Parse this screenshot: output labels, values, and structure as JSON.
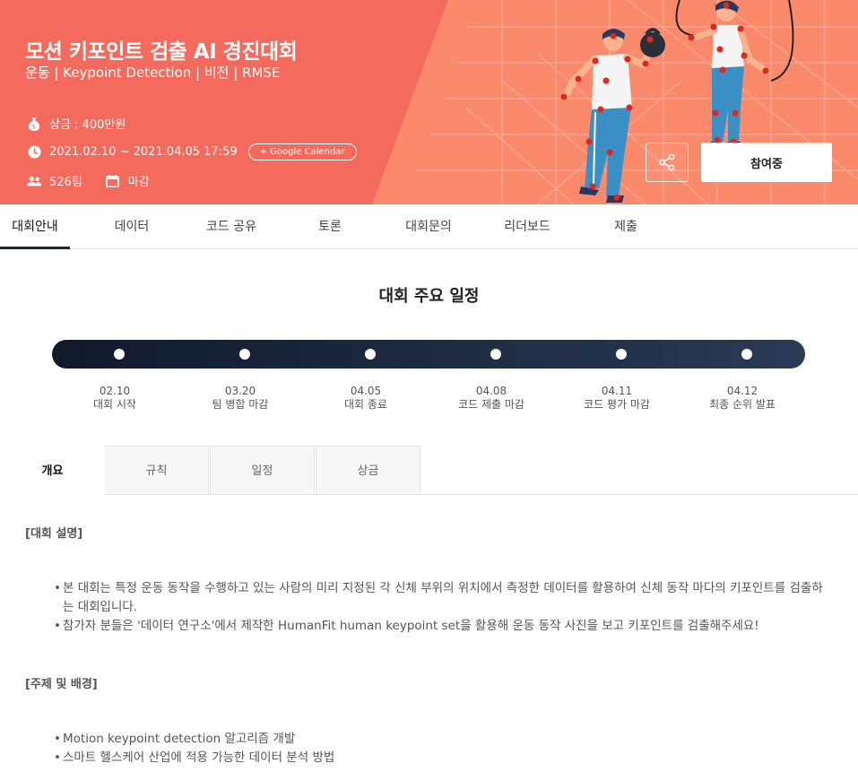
{
  "hero": {
    "title": "모션 키포인트 검출 AI 경진대회",
    "subtitle": "운동 | Keypoint Detection | 비전 | RMSE",
    "prize": "상금 : 400만원",
    "period": "2021.02.10 ~ 2021.04.05 17:59",
    "calendar_label": "+ Google Calendar",
    "teams": "526팀",
    "status": "마감",
    "join_label": "참여중",
    "bg_color": "#f46a5c"
  },
  "nav": {
    "items": [
      "대회안내",
      "데이터",
      "코드 공유",
      "토론",
      "대회문의",
      "리더보드",
      "제출"
    ],
    "active_index": 0
  },
  "schedule": {
    "title": "대회 주요 일정",
    "events": [
      {
        "date": "02.10",
        "label": "대회 시작"
      },
      {
        "date": "03.20",
        "label": "팀 병합 마감"
      },
      {
        "date": "04.05",
        "label": "대회 종료"
      },
      {
        "date": "04.08",
        "label": "코드 제출 마감"
      },
      {
        "date": "04.11",
        "label": "코드 평가 마감"
      },
      {
        "date": "04.12",
        "label": "최종 순위 발표"
      }
    ]
  },
  "tabs": [
    "개요",
    "규칙",
    "일정",
    "상금"
  ],
  "content": {
    "section1_title": "[대회 설명]",
    "section1_bullets": [
      "본 대회는 특정 운동 동작을 수행하고 있는 사람의 미리 지정된 각 신체 부위의 위치에서 측정한 데이터를 활용하여 신체 동작 마다의 키포인트를 검출하는 대회입니다.",
      "참가자 분들은 '데이터 연구소'에서 제작한 HumanFit human keypoint set을 활용해 운동 동작 사진을 보고 키포인트를 검출해주세요!"
    ],
    "section2_title": "[주제 및 배경]",
    "section2_bullets": [
      "Motion keypoint detection 알고리즘 개발",
      "스마트 헬스케어 산업에 적용 가능한 데이터 분석 방법"
    ]
  }
}
